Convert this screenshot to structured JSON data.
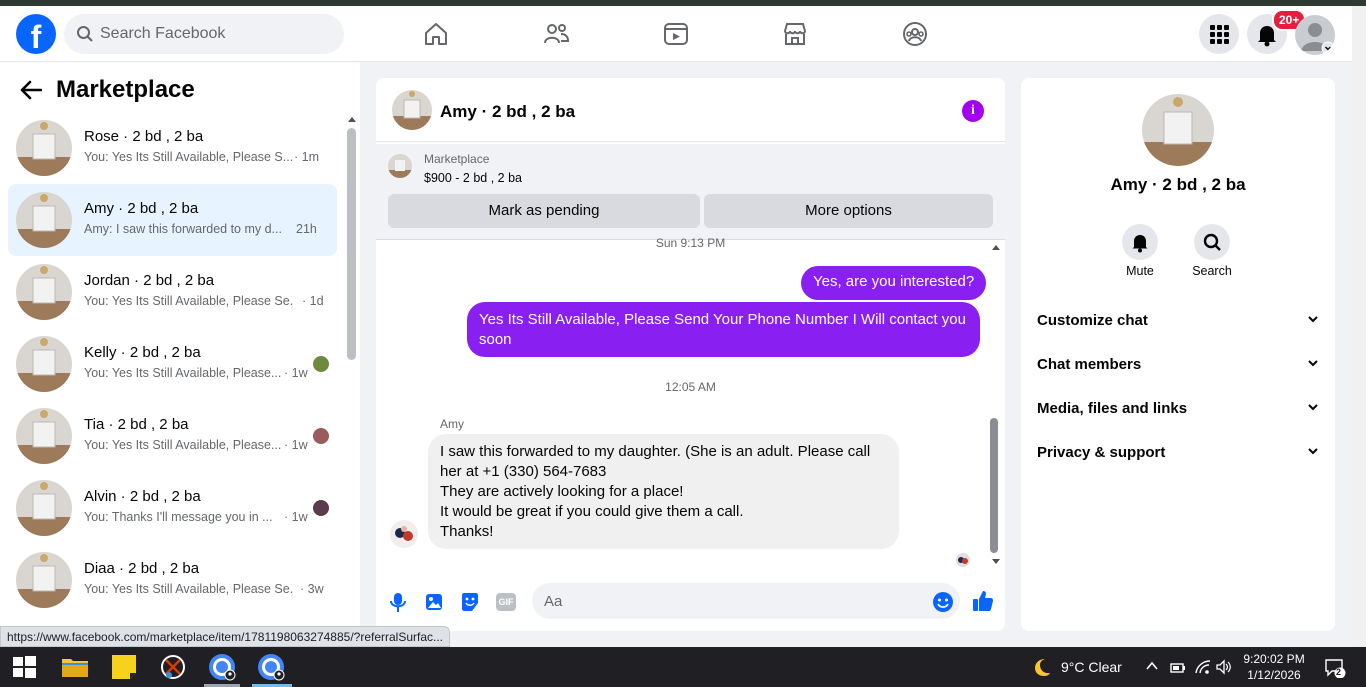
{
  "header": {
    "logo": "f",
    "search_placeholder": "Search Facebook",
    "notification_badge": "20+",
    "nav_icons": [
      "home-icon",
      "friends-icon",
      "watch-icon",
      "marketplace-icon",
      "groups-icon"
    ]
  },
  "sidebar": {
    "title": "Marketplace",
    "conversations": [
      {
        "name": "Rose · 2 bd , 2 ba",
        "snippet": "You: Yes Its Still Available, Please S...",
        "time": "· 1m"
      },
      {
        "name": "Amy · 2 bd , 2 ba",
        "snippet": "Amy: I saw this forwarded to my d...",
        "time": "21h"
      },
      {
        "name": "Jordan · 2 bd , 2 ba",
        "snippet": "You: Yes Its Still Available, Please Se...",
        "time": "· 1d"
      },
      {
        "name": "Kelly · 2 bd , 2 ba",
        "snippet": "You: Yes Its Still Available, Please...",
        "time": "· 1w"
      },
      {
        "name": "Tia · 2 bd , 2 ba",
        "snippet": "You: Yes Its Still Available, Please...",
        "time": "· 1w"
      },
      {
        "name": "Alvin · 2 bd , 2 ba",
        "snippet": "You: Thanks I'll message you in ...",
        "time": "· 1w"
      },
      {
        "name": "Diaa · 2 bd , 2 ba",
        "snippet": "You: Yes Its Still Available, Please Se...",
        "time": "· 3w"
      }
    ]
  },
  "chat": {
    "title": "Amy · 2 bd , 2 ba",
    "marketplace_label": "Marketplace",
    "listing": "$900 - 2 bd , 2 ba",
    "mark_pending": "Mark as pending",
    "more_options": "More options",
    "stamp_top": "Sun 9:13 PM",
    "msg_out_1": "Yes, are you interested?",
    "msg_out_2": "Yes Its Still Available, Please Send Your Phone Number I Will contact you soon",
    "stamp_mid": "12:05 AM",
    "sender": "Amy",
    "msg_in_lines": [
      "I saw this forwarded to my daughter. (She is an adult. Please call",
      "her at +1 (330) 564-7683",
      "They are actively looking for a place!",
      "It would be great if you could give them a call.",
      "Thanks!"
    ],
    "input_placeholder": "Aa",
    "gif_label": "GIF"
  },
  "right_panel": {
    "title": "Amy · 2 bd , 2 ba",
    "mute": "Mute",
    "search": "Search",
    "rows": [
      "Customize chat",
      "Chat members",
      "Media, files and links",
      "Privacy & support"
    ]
  },
  "status_url": "https://www.facebook.com/marketplace/item/1781198063274885/?referralSurfac...",
  "taskbar": {
    "weather": "9°C  Clear",
    "time": "9:20:02 PM",
    "date": "1/12/2026",
    "notifications": "2"
  },
  "colors": {
    "brand": "#0866ff",
    "outgoing": "#8a1ff2",
    "badge": "#e41e3f"
  }
}
